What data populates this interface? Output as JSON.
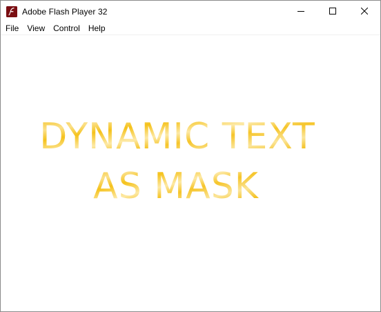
{
  "window": {
    "title": "Adobe Flash Player 32",
    "controls": {
      "minimize": "minimize-icon",
      "maximize": "maximize-icon",
      "close": "close-icon"
    }
  },
  "menu": {
    "items": [
      {
        "label": "File"
      },
      {
        "label": "View"
      },
      {
        "label": "Control"
      },
      {
        "label": "Help"
      }
    ]
  },
  "stage": {
    "lines": [
      "DYNAMIC TEXT",
      "AS MASK"
    ],
    "colors": {
      "primary": "#f5c21b",
      "light": "#fbe08a",
      "icon_bg": "#7a0e12"
    }
  }
}
